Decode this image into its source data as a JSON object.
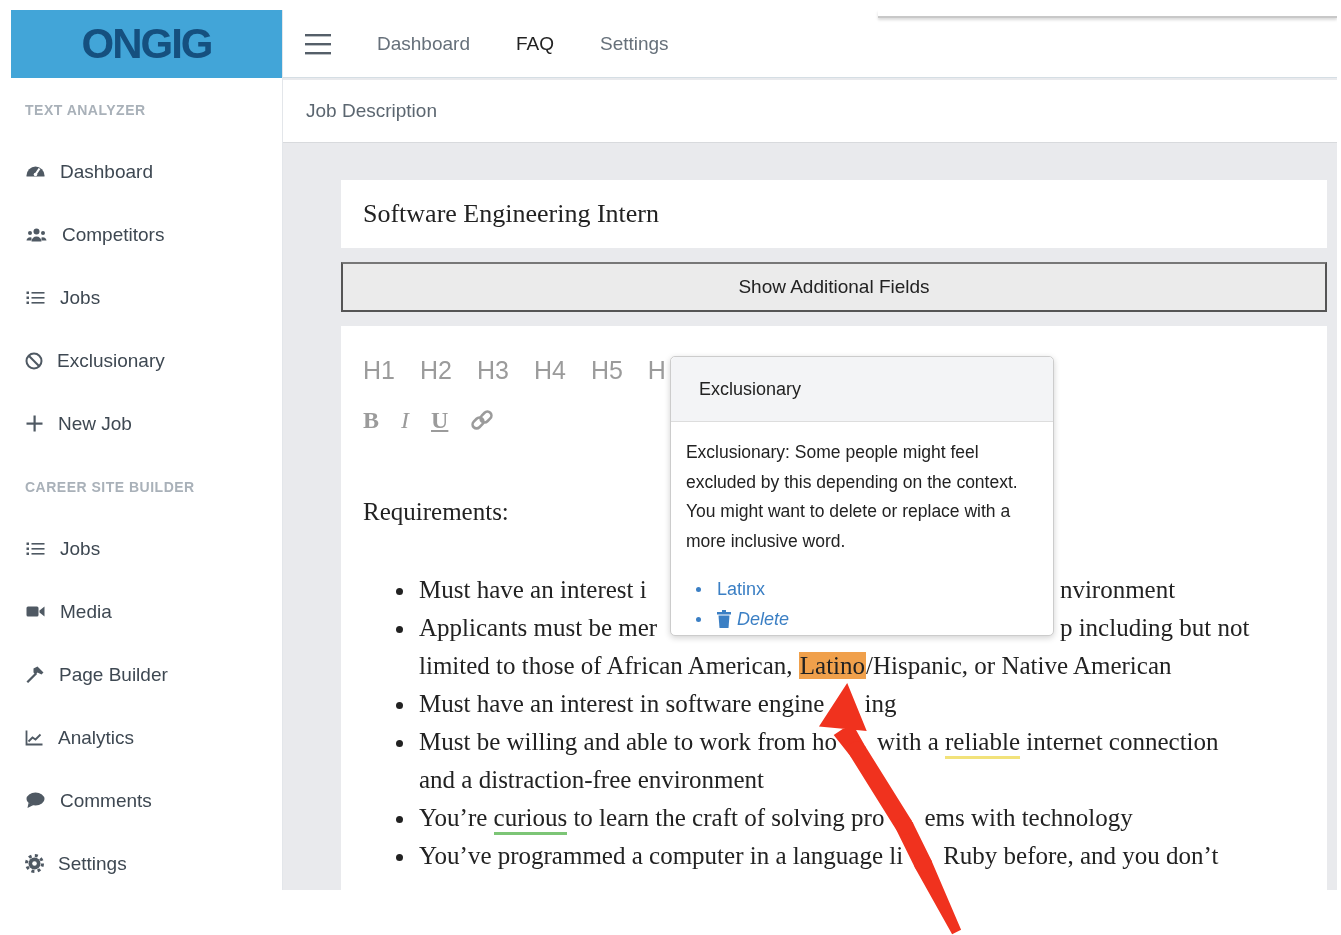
{
  "logo": "ONGIG",
  "nav": [
    {
      "label": "Dashboard",
      "selected": false
    },
    {
      "label": "FAQ",
      "selected": true
    },
    {
      "label": "Settings",
      "selected": false
    }
  ],
  "breadcrumb": "Job Description",
  "sidebar": {
    "sections": [
      {
        "title": "TEXT ANALYZER",
        "items": [
          {
            "label": "Dashboard",
            "kind": "gauge"
          },
          {
            "label": "Competitors",
            "kind": "users"
          },
          {
            "label": "Jobs",
            "kind": "list"
          },
          {
            "label": "Exclusionary",
            "kind": "ban"
          },
          {
            "label": "New Job",
            "kind": "plus"
          }
        ]
      },
      {
        "title": "CAREER SITE BUILDER",
        "items": [
          {
            "label": "Jobs",
            "kind": "list"
          },
          {
            "label": "Media",
            "kind": "video"
          },
          {
            "label": "Page Builder",
            "kind": "hammer"
          },
          {
            "label": "Analytics",
            "kind": "chart"
          },
          {
            "label": "Comments",
            "kind": "comment"
          },
          {
            "label": "Settings",
            "kind": "gear"
          }
        ]
      }
    ]
  },
  "job_title": "Software Engineering Intern",
  "additional_fields_button": "Show Additional Fields",
  "editor": {
    "headings": [
      "H1",
      "H2",
      "H3",
      "H4",
      "H5",
      "H"
    ],
    "format_buttons": [
      {
        "kind": "bold",
        "label": "B"
      },
      {
        "kind": "italic",
        "label": "I"
      },
      {
        "kind": "underline",
        "label": "U"
      },
      {
        "kind": "link"
      }
    ],
    "heading_text": "Requirements:",
    "bullets": [
      {
        "lines": [
          [
            {
              "kind": "plain",
              "text": "Must have an interest i"
            },
            {
              "kind": "popover_gap"
            },
            {
              "kind": "plain",
              "text": "nvironment"
            }
          ]
        ]
      },
      {
        "lines": [
          [
            {
              "kind": "plain",
              "text": "Applicants must be mer"
            },
            {
              "kind": "popover_gap"
            },
            {
              "kind": "plain",
              "text": "p including but not"
            }
          ],
          [
            {
              "kind": "plain",
              "text": "limited to those of African American, "
            },
            {
              "kind": "highlight",
              "text": "Latino",
              "color": "#f0a04b"
            },
            {
              "kind": "plain",
              "text": "/Hispanic, or Native American"
            }
          ]
        ]
      },
      {
        "lines": [
          [
            {
              "kind": "plain",
              "text": "Must have an interest in software engine"
            },
            {
              "kind": "arrow_gap"
            },
            {
              "kind": "plain",
              "text": "ing"
            }
          ]
        ]
      },
      {
        "lines": [
          [
            {
              "kind": "plain",
              "text": "Must be willing and able to work from ho"
            },
            {
              "kind": "arrow_gap"
            },
            {
              "kind": "plain",
              "text": "with a "
            },
            {
              "kind": "underline",
              "text": "reliable",
              "color": "#f2e27a"
            },
            {
              "kind": "plain",
              "text": " internet connection"
            }
          ],
          [
            {
              "kind": "plain",
              "text": "and a distraction-free environment"
            }
          ]
        ]
      },
      {
        "lines": [
          [
            {
              "kind": "plain",
              "text": "You’re "
            },
            {
              "kind": "underline",
              "text": "curious",
              "color": "#7cc576"
            },
            {
              "kind": "plain",
              "text": " to learn the craft of solving pro"
            },
            {
              "kind": "arrow_gap"
            },
            {
              "kind": "plain",
              "text": "ems with technology"
            }
          ]
        ]
      },
      {
        "lines": [
          [
            {
              "kind": "plain",
              "text": "You’ve programmed a computer in a language li"
            },
            {
              "kind": "arrow_gap"
            },
            {
              "kind": "plain",
              "text": "Ruby before, and you don’t"
            }
          ]
        ]
      }
    ]
  },
  "popover": {
    "title": "Exclusionary",
    "message": "Exclusionary: Some people might feel excluded by this depending on the context. You might want to delete or replace with a more inclusive word.",
    "actions": [
      {
        "kind": "replace",
        "label": "Latinx"
      },
      {
        "kind": "delete",
        "label": "Delete"
      }
    ]
  },
  "annotation": {
    "kind": "arrow"
  }
}
